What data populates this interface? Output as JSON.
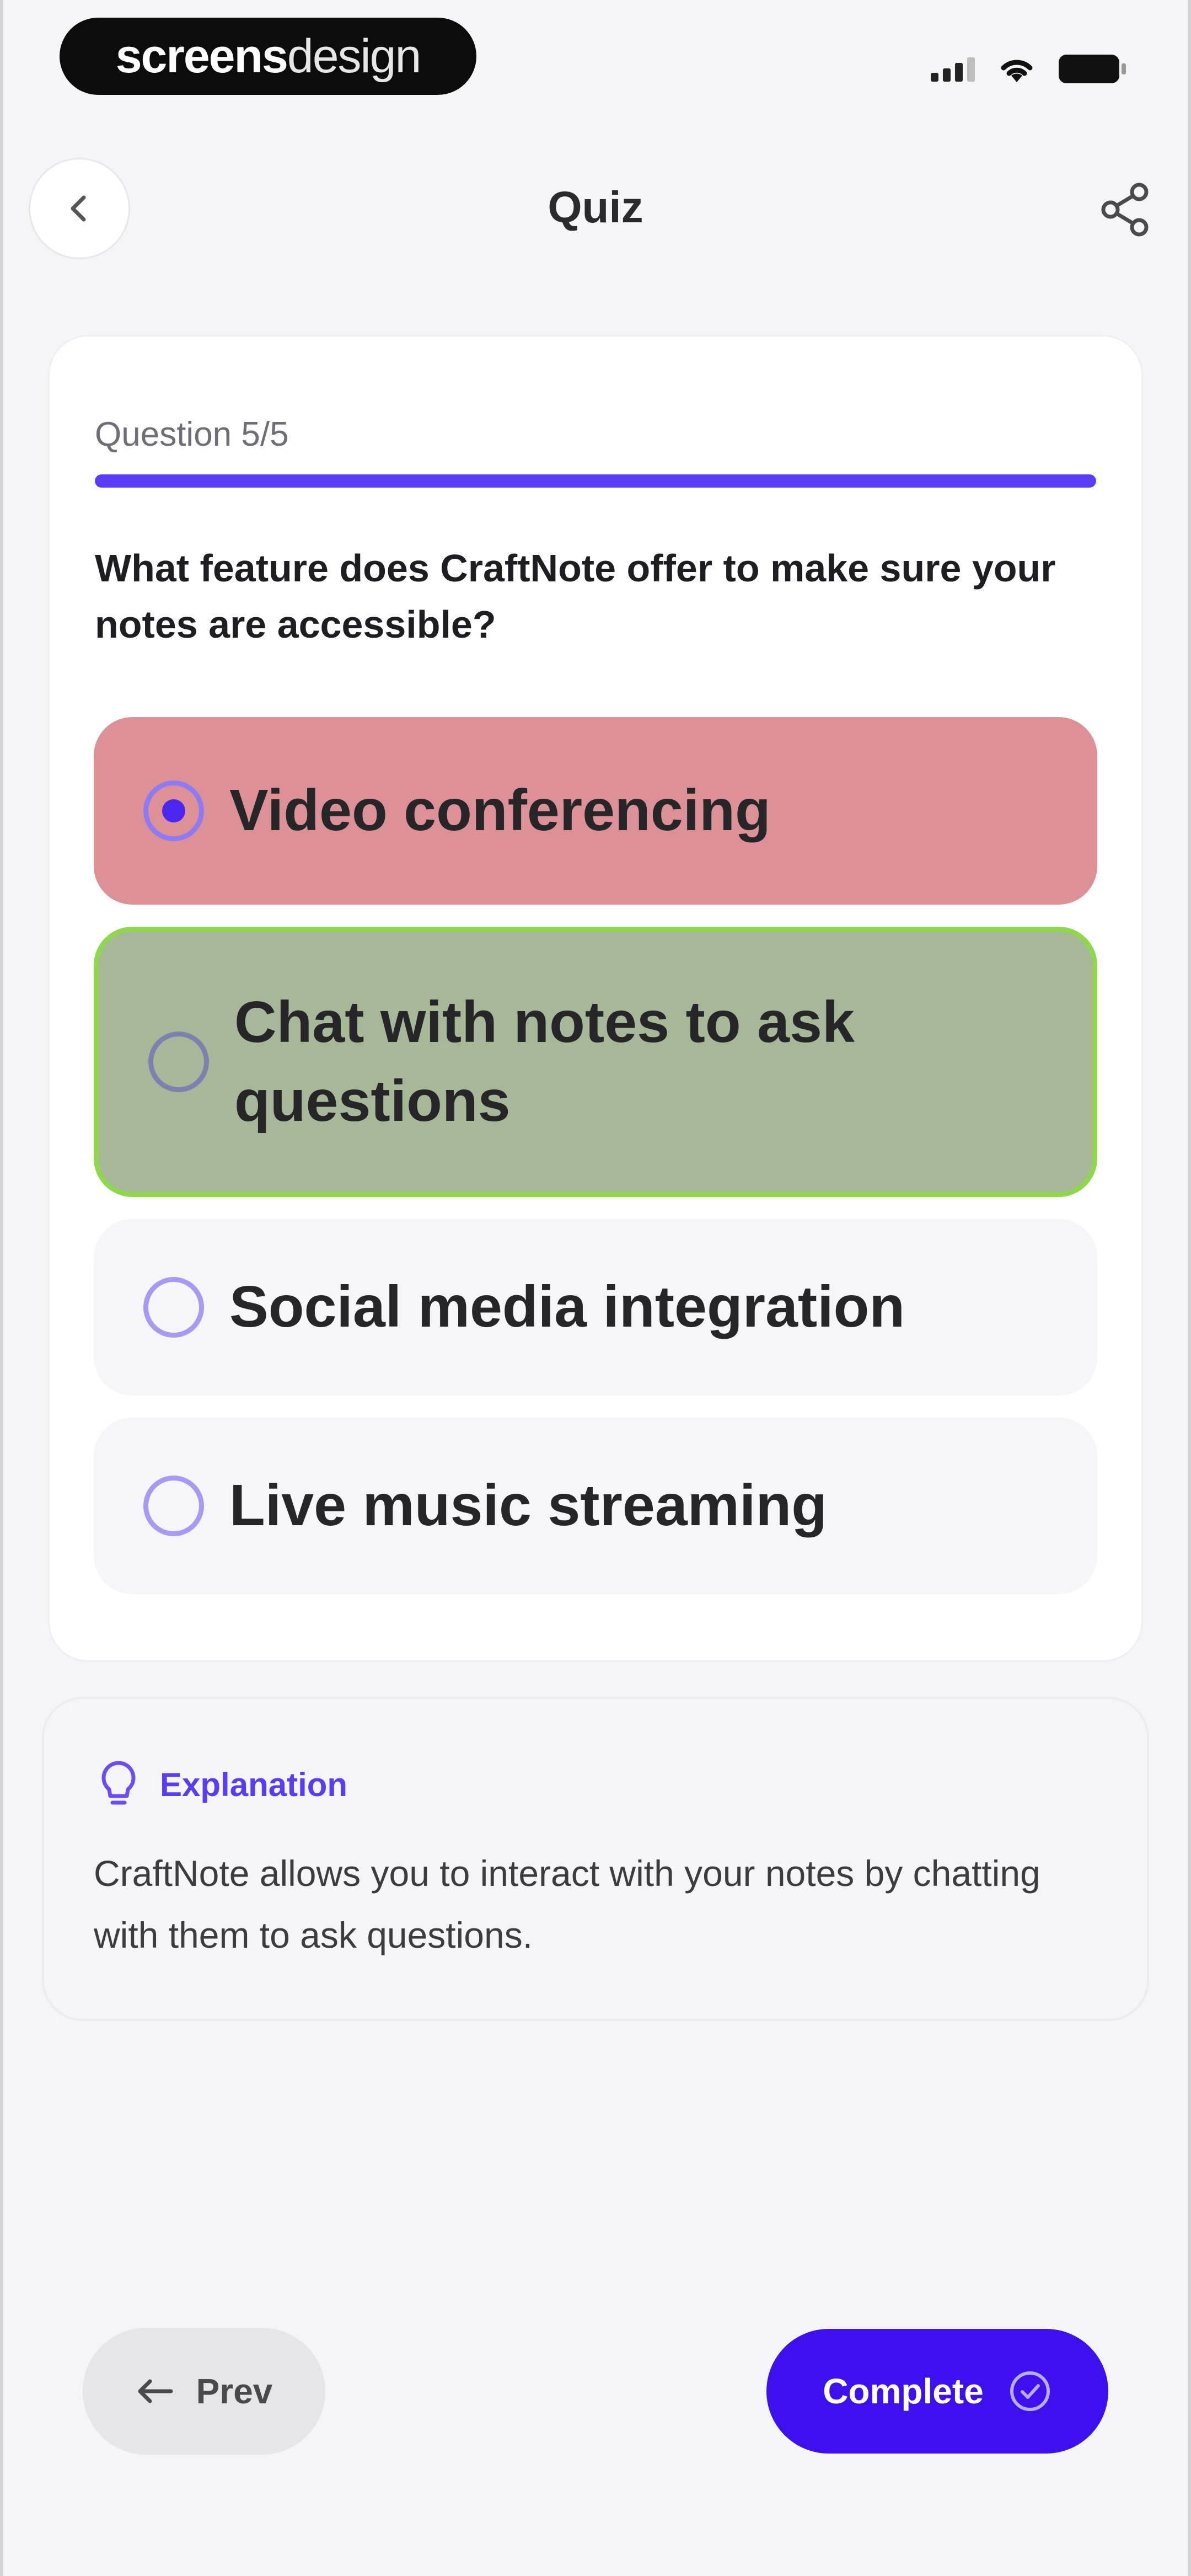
{
  "status_bar": {
    "brand_strong": "screens",
    "brand_light": "design"
  },
  "nav": {
    "title": "Quiz"
  },
  "quiz": {
    "counter": "Question 5/5",
    "progress_fraction": 1.0,
    "question": "What feature does CraftNote offer to make sure your notes are accessible?",
    "options": [
      {
        "label": "Video conferencing",
        "state": "selected-incorrect"
      },
      {
        "label": "Chat with notes to ask questions",
        "state": "correct"
      },
      {
        "label": "Social media integration",
        "state": "unselected"
      },
      {
        "label": "Live music streaming",
        "state": "unselected"
      }
    ]
  },
  "explanation": {
    "icon": "lightbulb-icon",
    "title": "Explanation",
    "text": "CraftNote allows you to interact with your notes by chatting with them to ask questions."
  },
  "footer": {
    "prev_label": "Prev",
    "complete_label": "Complete"
  },
  "colors": {
    "accent": "#3d10ee",
    "incorrect": "#dc9197",
    "correct": "#a7b898",
    "correct_border": "#8fd84e"
  }
}
